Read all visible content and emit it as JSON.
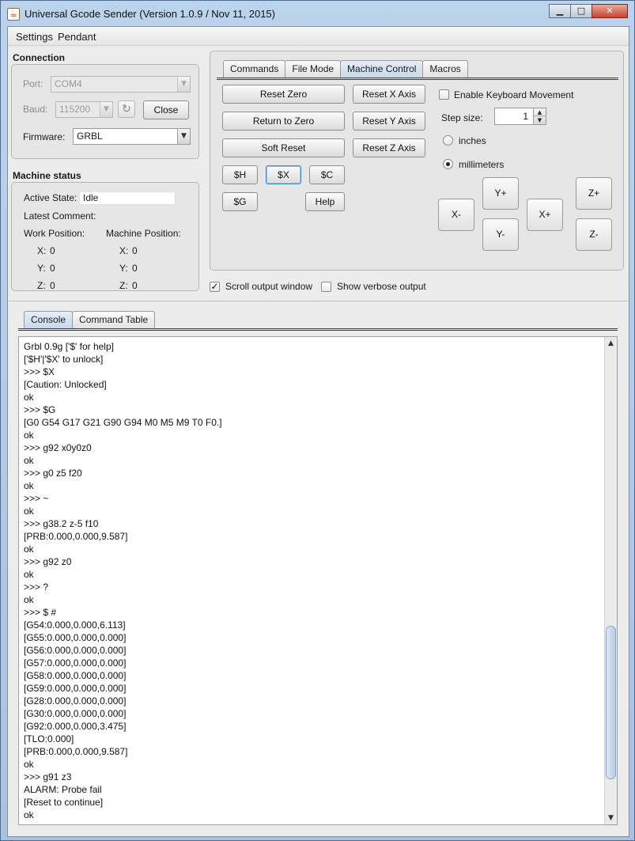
{
  "window": {
    "title": "Universal Gcode Sender (Version 1.0.9 / Nov 11, 2015)",
    "app_icon_glyph": "☕",
    "minimize_glyph": "▁",
    "maximize_glyph": "□",
    "close_glyph": "✕"
  },
  "menu": {
    "settings": "Settings",
    "pendant": "Pendant"
  },
  "connection": {
    "title": "Connection",
    "port_label": "Port:",
    "port_value": "COM4",
    "baud_label": "Baud:",
    "baud_value": "115200",
    "refresh_icon": "↻",
    "close_button": "Close",
    "firmware_label": "Firmware:",
    "firmware_value": "GRBL",
    "combo_arrow": "▼"
  },
  "machine_status": {
    "title": "Machine status",
    "active_state_label": "Active State:",
    "active_state_value": "Idle",
    "latest_comment_label": "Latest Comment:",
    "latest_comment_value": "",
    "work_position_label": "Work Position:",
    "machine_position_label": "Machine Position:",
    "work": {
      "x_label": "X:",
      "x": "0",
      "y_label": "Y:",
      "y": "0",
      "z_label": "Z:",
      "z": "0"
    },
    "machine": {
      "x_label": "X:",
      "x": "0",
      "y_label": "Y:",
      "y": "0",
      "z_label": "Z:",
      "z": "0"
    }
  },
  "top_tabs": [
    "Commands",
    "File Mode",
    "Machine Control",
    "Macros"
  ],
  "top_tabs_active": "Machine Control",
  "machine_control": {
    "reset_zero": "Reset Zero",
    "return_to_zero": "Return to Zero",
    "soft_reset": "Soft Reset",
    "reset_x": "Reset X Axis",
    "reset_y": "Reset Y Axis",
    "reset_z": "Reset Z Axis",
    "h": "$H",
    "x": "$X",
    "c": "$C",
    "g": "$G",
    "help": "Help",
    "enable_keyboard": "Enable Keyboard Movement",
    "enable_keyboard_checked": false,
    "step_size_label": "Step size:",
    "step_size_value": "1",
    "spin_up": "▲",
    "spin_down": "▼",
    "inches": "inches",
    "millimeters": "millimeters",
    "unit_selected": "millimeters",
    "jog": {
      "x_minus": "X-",
      "x_plus": "X+",
      "y_plus": "Y+",
      "y_minus": "Y-",
      "z_plus": "Z+",
      "z_minus": "Z-"
    }
  },
  "options": {
    "scroll_output": "Scroll output window",
    "scroll_output_checked": true,
    "verbose_output": "Show verbose output",
    "verbose_output_checked": false,
    "check_glyph": "✓"
  },
  "bottom_tabs": [
    "Console",
    "Command Table"
  ],
  "bottom_tabs_active": "Console",
  "console_lines": [
    "Grbl 0.9g ['$' for help]",
    "['$H'|'$X' to unlock]",
    ">>> $X",
    "[Caution: Unlocked]",
    "ok",
    ">>> $G",
    "[G0 G54 G17 G21 G90 G94 M0 M5 M9 T0 F0.]",
    "ok",
    ">>> g92 x0y0z0",
    "ok",
    ">>> g0 z5 f20",
    "ok",
    ">>> ~",
    "ok",
    ">>> g38.2 z-5 f10",
    "[PRB:0.000,0.000,9.587]",
    "ok",
    ">>> g92 z0",
    "ok",
    ">>> ?",
    "ok",
    ">>> $ #",
    "[G54:0.000,0.000,6.113]",
    "[G55:0.000,0.000,0.000]",
    "[G56:0.000,0.000,0.000]",
    "[G57:0.000,0.000,0.000]",
    "[G58:0.000,0.000,0.000]",
    "[G59:0.000,0.000,0.000]",
    "[G28:0.000,0.000,0.000]",
    "[G30:0.000,0.000,0.000]",
    "[G92:0.000,0.000,3.475]",
    "[TLO:0.000]",
    "[PRB:0.000,0.000,9.587]",
    "ok",
    ">>> g91 z3",
    "ALARM: Probe fail",
    "[Reset to continue]",
    "ok"
  ],
  "scrollbar": {
    "up": "▲",
    "down": "▼"
  }
}
